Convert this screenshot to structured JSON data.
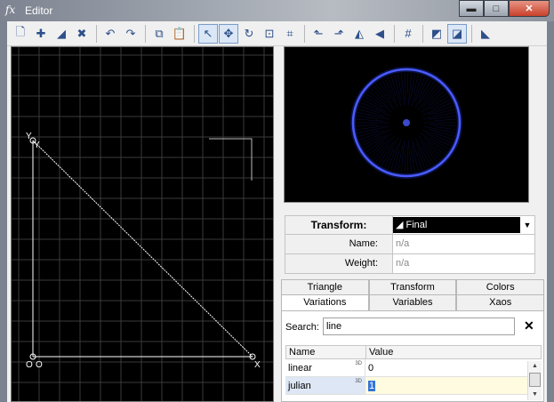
{
  "window": {
    "title": "Editor",
    "icon_glyph": "fx",
    "controls": {
      "minimize": "▬",
      "maximize": "□",
      "close": "✕"
    }
  },
  "toolbar": {
    "groups": [
      [
        {
          "name": "new-flame-icon",
          "glyph": "🗋"
        },
        {
          "name": "add-transform-icon",
          "glyph": "✚"
        },
        {
          "name": "duplicate-transform-icon",
          "glyph": "◢"
        },
        {
          "name": "delete-transform-icon",
          "glyph": "✖"
        }
      ],
      [
        {
          "name": "undo-icon",
          "glyph": "↶"
        },
        {
          "name": "redo-icon",
          "glyph": "↷"
        }
      ],
      [
        {
          "name": "copy-icon",
          "glyph": "⧉"
        },
        {
          "name": "paste-icon",
          "glyph": "📋"
        }
      ],
      [
        {
          "name": "select-pointer-icon",
          "glyph": "↖",
          "active": true
        },
        {
          "name": "move-icon",
          "glyph": "✥",
          "active": true
        },
        {
          "name": "rotate-icon",
          "glyph": "↻"
        },
        {
          "name": "scale-icon",
          "glyph": "⊡"
        },
        {
          "name": "zoom-fit-icon",
          "glyph": "⌗"
        }
      ],
      [
        {
          "name": "rotate-left-icon",
          "glyph": "⬑"
        },
        {
          "name": "rotate-right-icon",
          "glyph": "⬏"
        },
        {
          "name": "flip-horizontal-icon",
          "glyph": "◭"
        },
        {
          "name": "flip-vertical-icon",
          "glyph": "◀"
        }
      ],
      [
        {
          "name": "grid-toggle-icon",
          "glyph": "#"
        }
      ],
      [
        {
          "name": "pre-affine-icon",
          "glyph": "◩"
        },
        {
          "name": "post-affine-icon",
          "glyph": "◪",
          "active": true
        }
      ],
      [
        {
          "name": "transform-options-icon",
          "glyph": "◣"
        }
      ]
    ]
  },
  "canvas": {
    "labels": {
      "y": "Y",
      "o": "O",
      "x": "X"
    },
    "colors": {
      "background": "#000000",
      "grid": "#3a3a3a",
      "triangle": "#ffffff"
    }
  },
  "preview": {
    "colors": {
      "background": "#000000",
      "ring": "#4a5cff",
      "glow": "#2233cc"
    }
  },
  "properties": {
    "transform_label": "Transform:",
    "transform_value": "Final",
    "name_label": "Name:",
    "name_value": "n/a",
    "weight_label": "Weight:",
    "weight_value": "n/a"
  },
  "tabs": {
    "row1": [
      "Triangle",
      "Transform",
      "Colors"
    ],
    "row2": [
      "Variations",
      "Variables",
      "Xaos"
    ],
    "selected": "Variations"
  },
  "variations": {
    "search_label": "Search:",
    "search_value": "line",
    "clear_glyph": "✕",
    "columns": [
      "Name",
      "Value"
    ],
    "rows": [
      {
        "name": "linear",
        "badge": "3D",
        "value": "0"
      },
      {
        "name": "julian",
        "badge": "3D",
        "value": "1",
        "selected": true
      }
    ]
  }
}
